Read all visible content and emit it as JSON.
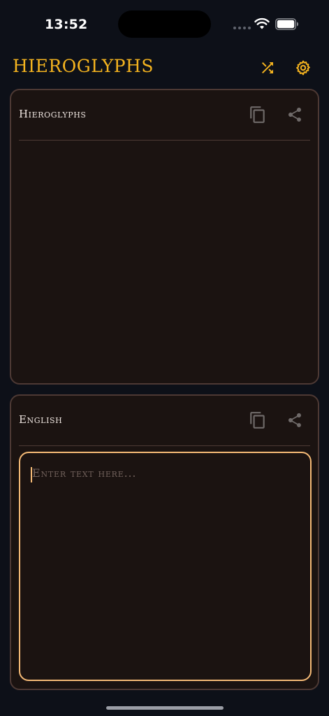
{
  "status_bar": {
    "time": "13:52"
  },
  "header": {
    "title": "HIEROGLYPHS",
    "shuffle_icon": "shuffle-icon",
    "settings_icon": "gear-icon"
  },
  "hieroglyphs_panel": {
    "label": "Hieroglyphs",
    "copy_icon": "copy-icon",
    "share_icon": "share-icon",
    "content": ""
  },
  "english_panel": {
    "label": "English",
    "copy_icon": "copy-icon",
    "share_icon": "share-icon",
    "input_value": "",
    "placeholder": "Enter text here..."
  },
  "colors": {
    "accent": "#f4b31f",
    "input_border": "#f5ba76",
    "panel_bg": "#1b1311",
    "panel_border": "#4d3934",
    "app_bg": "#0d1018"
  }
}
